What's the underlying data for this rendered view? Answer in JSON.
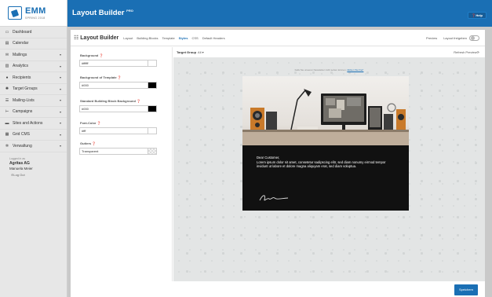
{
  "brand": {
    "name": "EMM",
    "edition": "SPRING 2018"
  },
  "nav": [
    {
      "icon": "▭",
      "icon_name": "dashboard-icon",
      "label": "Dashboard",
      "caret": false
    },
    {
      "icon": "▤",
      "icon_name": "calendar-icon",
      "label": "Calendar",
      "caret": false
    },
    {
      "icon": "✉",
      "icon_name": "envelope-icon",
      "label": "Mailings",
      "caret": true
    },
    {
      "icon": "▥",
      "icon_name": "analytics-icon",
      "label": "Analytics",
      "caret": true
    },
    {
      "icon": "●",
      "icon_name": "user-icon",
      "label": "Recipients",
      "caret": true
    },
    {
      "icon": "✺",
      "icon_name": "target-groups-icon",
      "label": "Target Groups",
      "caret": true
    },
    {
      "icon": "☰",
      "icon_name": "list-icon",
      "label": "Mailing-Lists",
      "caret": true
    },
    {
      "icon": "⊢",
      "icon_name": "campaigns-icon",
      "label": "Campaigns",
      "caret": true
    },
    {
      "icon": "▬",
      "icon_name": "sites-icon",
      "label": "Sites and Actions",
      "caret": true
    },
    {
      "icon": "▦",
      "icon_name": "grid-icon",
      "label": "Grid CMS",
      "caret": true
    },
    {
      "icon": "✲",
      "icon_name": "gear-icon",
      "label": "Verwaltung",
      "caret": true
    }
  ],
  "login": {
    "caption": "Logged in as",
    "company": "Agritas AG",
    "user": "Manuela Meier",
    "logout": "⊖Log Out"
  },
  "topbar": {
    "title": "Layout Builder",
    "badge": "PRO",
    "help": "❓Help"
  },
  "toolbar": {
    "icon": "☷",
    "title": "Layout Builder",
    "tabs": [
      "Layout",
      "Building Blocks",
      "Template",
      "Styles",
      "CSS",
      "Default Headers"
    ],
    "active_tab": "Styles",
    "preview": "Preview",
    "freeze": "Layout freigeben"
  },
  "style_fields": [
    {
      "label": "Background ❓",
      "value": "#ffffff",
      "color": "#ffffff"
    },
    {
      "label": "Background of Template ❓",
      "value": "#000",
      "color": "#000000"
    },
    {
      "label": "Standard Building Block Background ❓",
      "value": "#000",
      "color": "#000000"
    },
    {
      "label": "Font-Color ❓",
      "value": "#fff",
      "color": "#ffffff"
    },
    {
      "label": "Gutters ❓",
      "value": "Transparent",
      "color": "transparent"
    }
  ],
  "preview": {
    "target_label": "Target Group",
    "target_value": "All ▾",
    "refresh": "Refresh Preview⟳",
    "note_text": "Falls Sie unseren Newsletter nicht sehen können,",
    "note_link": "klicken Sie hier!"
  },
  "email": {
    "greeting": "Dear Customer,",
    "body": "Lorem ipsum dolor sit amet, consetetur sadipscing elitr, sed diam nonumy eirmod tempor invidunt ut labore et dolore magna aliquyam erat, sed diam voluptua."
  },
  "save_label": "Speichern"
}
